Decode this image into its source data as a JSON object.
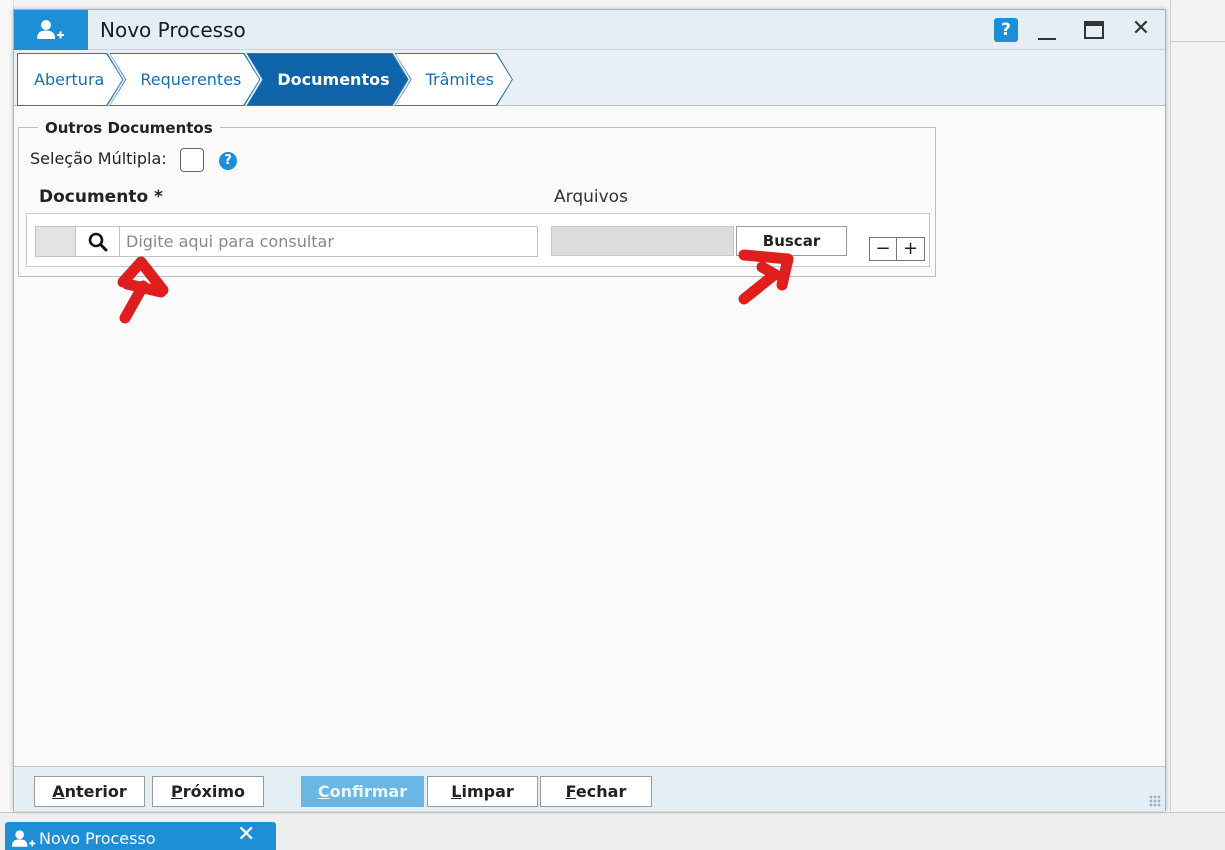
{
  "window": {
    "title": "Novo Processo",
    "help_label": "?",
    "close_label": "✕"
  },
  "wizard": {
    "tabs": [
      {
        "label": "Abertura",
        "active": false
      },
      {
        "label": "Requerentes",
        "active": false
      },
      {
        "label": "Documentos",
        "active": true
      },
      {
        "label": "Trâmites",
        "active": false
      }
    ]
  },
  "outros_documentos": {
    "legend": "Outros Documentos",
    "multi_select_label": "Seleção Múltipla:",
    "multi_select_checked": false,
    "help_label": "?",
    "column_documento": "Documento *",
    "column_arquivos": "Arquivos",
    "search_placeholder": "Digite aqui para consultar",
    "search_value": "",
    "buscar_label": "Buscar",
    "remove_label": "−",
    "add_label": "+"
  },
  "footer": {
    "anterior_first": "A",
    "anterior_rest": "nterior",
    "proximo_first": "P",
    "proximo_rest": "róximo",
    "confirmar_first": "C",
    "confirmar_rest": "onfirmar",
    "limpar_first": "L",
    "limpar_rest": "impar",
    "fechar_first": "F",
    "fechar_rest": "echar"
  },
  "taskbar": {
    "item_label": "Novo Processo",
    "close_label": "✕"
  },
  "colors": {
    "brand_blue": "#1e8fd6",
    "active_tab": "#0f63a8",
    "annotation_red": "#e01e1e"
  },
  "icons": {
    "title_icon": "add-user-icon",
    "lookup_icon": "search-icon"
  }
}
